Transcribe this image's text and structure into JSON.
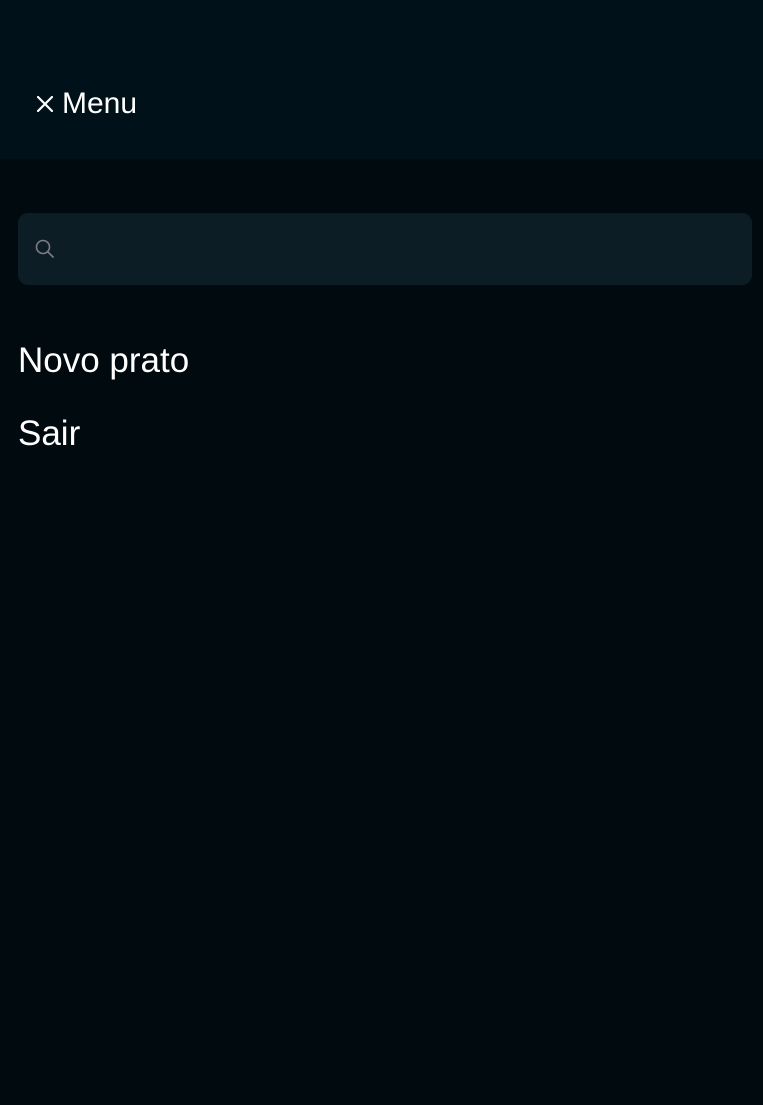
{
  "header": {
    "close_icon": "close-icon",
    "close_label": "Menu"
  },
  "search": {
    "icon": "search-icon",
    "value": "",
    "placeholder": ""
  },
  "menu": {
    "items": [
      {
        "label": "Novo prato"
      },
      {
        "label": "Sair"
      }
    ]
  },
  "colors": {
    "header_bg": "#00111a",
    "page_bg": "#000a0f",
    "search_bg": "#0d1d25",
    "text": "#ffffff",
    "icon_muted": "#7c7c8a"
  }
}
